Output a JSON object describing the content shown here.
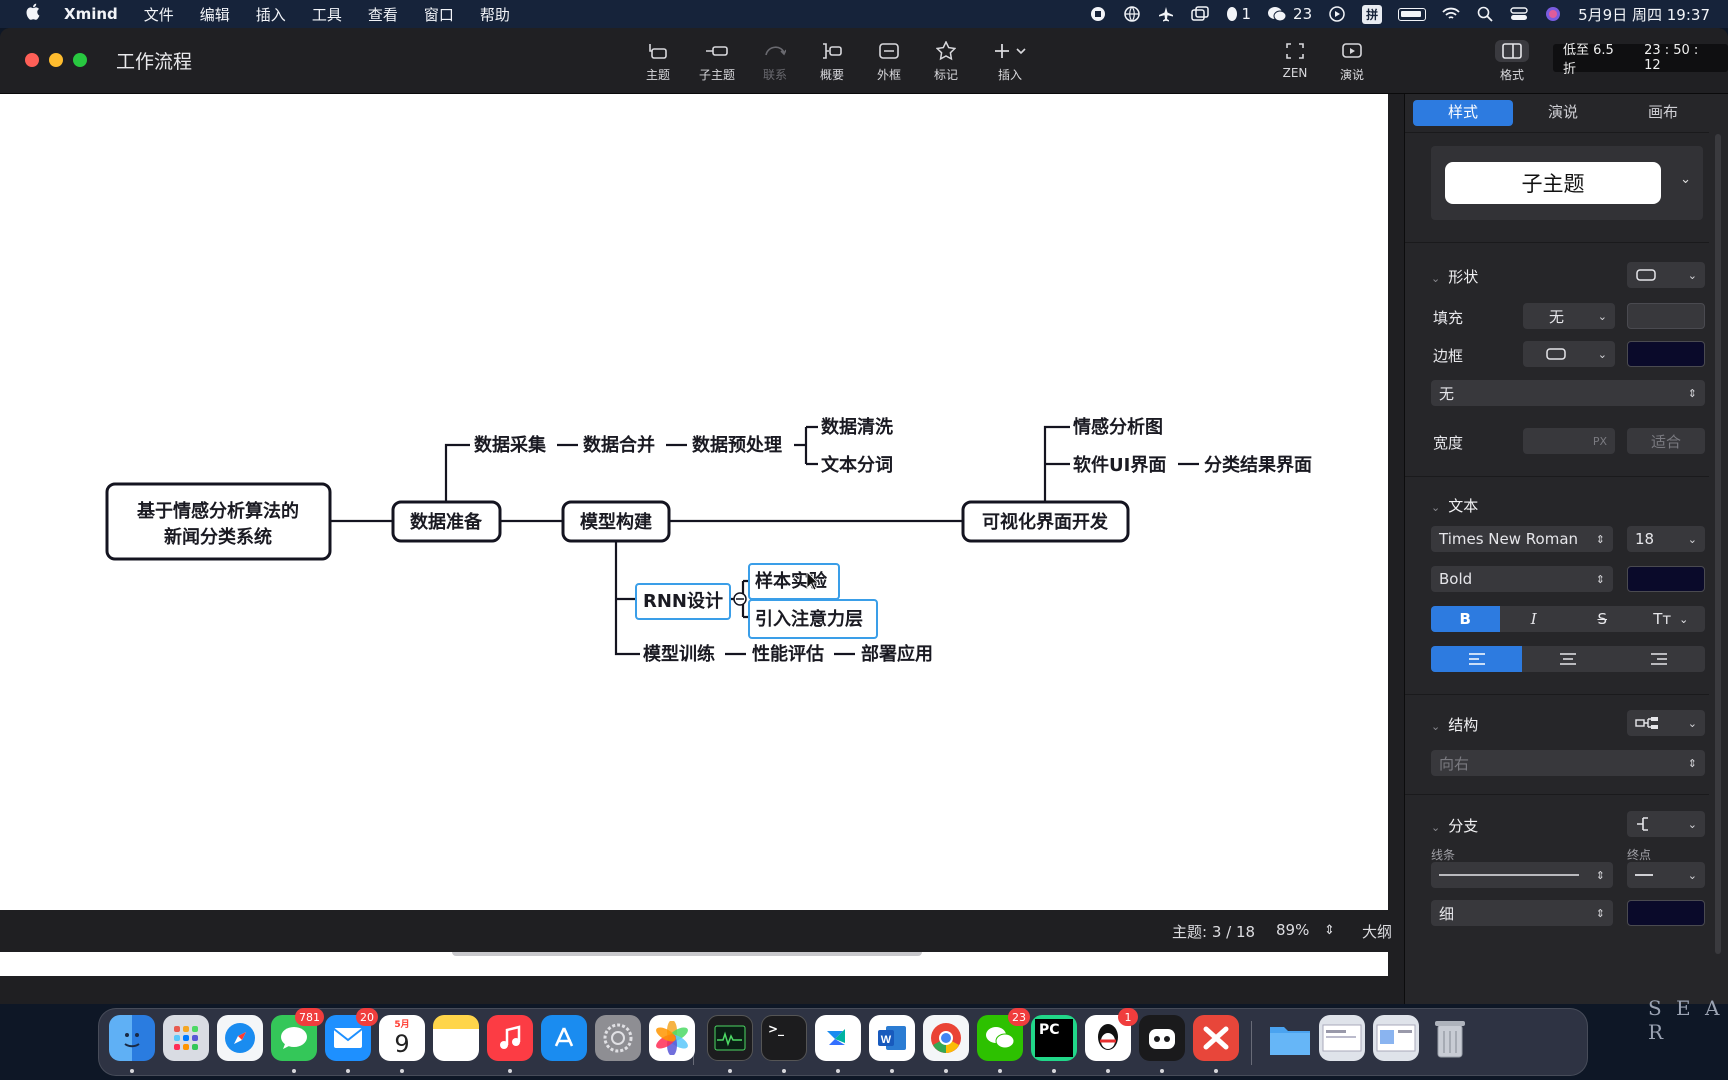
{
  "menubar": {
    "app_name": "Xmind",
    "menus": [
      "文件",
      "编辑",
      "插入",
      "工具",
      "查看",
      "窗口",
      "帮助"
    ],
    "qq_count": "1",
    "wechat_count": "23",
    "ime": "拼",
    "datetime": "5月9日 周四  19:37"
  },
  "window": {
    "title": "工作流程",
    "toolbar": {
      "topic": "主题",
      "subtopic": "子主题",
      "relationship": "联系",
      "summary": "概要",
      "boundary": "外框",
      "marker": "标记",
      "insert": "插入",
      "zen": "ZEN",
      "pitch": "演说",
      "format": "格式"
    },
    "promo": "低至 6.5 折",
    "countdown": "23 : 50 : 12"
  },
  "mindmap": {
    "root": "基于情感分析算法的",
    "root_line2": "新闻分类系统",
    "main_topics": {
      "data_prep": "数据准备",
      "model_build": "模型构建",
      "ui_dev": "可视化界面开发"
    },
    "data_chain": [
      "数据采集",
      "数据合并",
      "数据预处理"
    ],
    "preprocess_children": [
      "数据清洗",
      "文本分词"
    ],
    "rnn": "RNN设计",
    "rnn_children": [
      "样本实验",
      "引入注意力层"
    ],
    "train_chain": [
      "模型训练",
      "性能评估",
      "部署应用"
    ],
    "ui_children": [
      "情感分析图",
      "软件UI界面"
    ],
    "ui_result": "分类结果界面"
  },
  "status": {
    "topic_count": "主题: 3 / 18",
    "zoom": "89%",
    "outline": "大纲"
  },
  "panel": {
    "tabs": [
      "样式",
      "演说",
      "画布"
    ],
    "style_name": "子主题",
    "shape": {
      "title": "形状",
      "fill_label": "填充",
      "fill_value": "无",
      "border_label": "边框",
      "border_pattern": "无",
      "width_label": "宽度",
      "width_unit": "PX",
      "fit": "适合"
    },
    "text": {
      "title": "文本",
      "font": "Times New Roman",
      "size": "18",
      "weight": "Bold",
      "bold": "B",
      "italic": "I",
      "strike": "S",
      "case": "Tт"
    },
    "structure": {
      "title": "结构",
      "direction": "向右"
    },
    "branch": {
      "title": "分支",
      "line_label": "线条",
      "end_label": "终点",
      "thickness": "细"
    },
    "colors": {
      "border_color": "#0a0a2a",
      "text_color": "#0a0a2a",
      "branch_color": "#0a0a2a",
      "accent": "#2d7be0"
    }
  },
  "dock": {
    "messages_badge": "781",
    "mail_badge": "20",
    "calendar_month": "5月",
    "calendar_day": "9",
    "wechat_badge": "23",
    "qq_badge": "1"
  },
  "wallpaper_text": "S E A R"
}
